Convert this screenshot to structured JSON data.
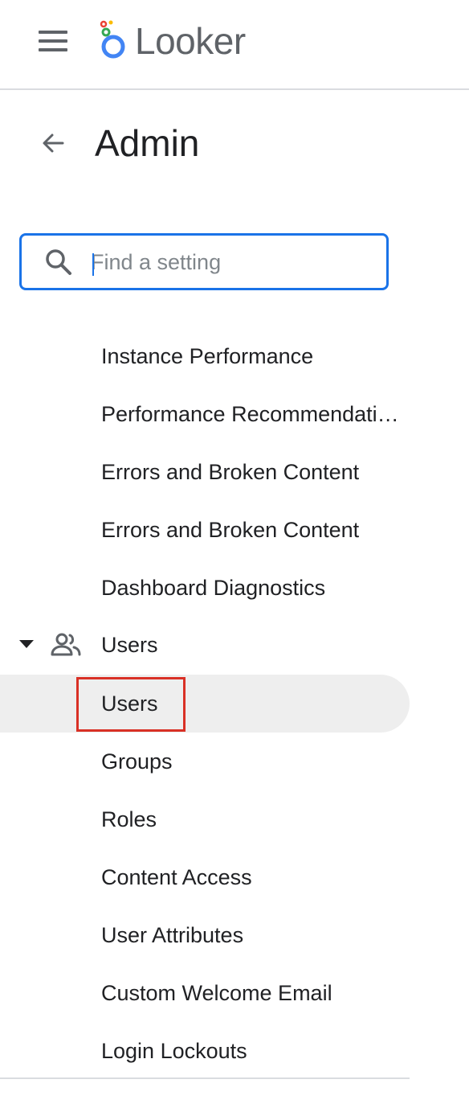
{
  "header": {
    "brand": "Looker",
    "logo_colors": {
      "ring": "#4285f4",
      "dot_red": "#ea4335",
      "dot_yellow": "#fbbc04",
      "dot_green": "#34a853"
    }
  },
  "page": {
    "title": "Admin"
  },
  "search": {
    "placeholder": "Find a setting",
    "value": ""
  },
  "menu": {
    "items_above": [
      "Instance Performance",
      "Performance Recommendati…",
      "Errors and Broken Content",
      "Errors and Broken Content",
      "Dashboard Diagnostics"
    ],
    "users_group": {
      "label": "Users",
      "expanded": true,
      "items": [
        "Users",
        "Groups",
        "Roles",
        "Content Access",
        "User Attributes",
        "Custom Welcome Email",
        "Login Lockouts"
      ],
      "selected": "Users"
    }
  },
  "colors": {
    "accent": "#1a73e8",
    "highlight_border": "#d93025",
    "selected_bg": "#eeeeee"
  }
}
